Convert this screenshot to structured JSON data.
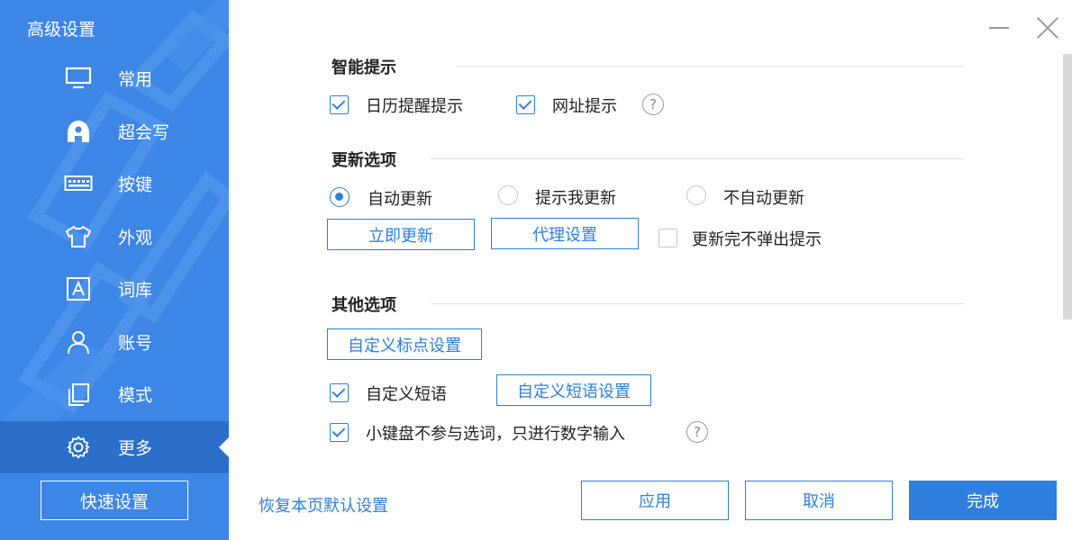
{
  "window": {
    "title": "高级设置"
  },
  "sidebar": {
    "items": [
      {
        "label": "常用",
        "icon": "monitor-icon"
      },
      {
        "label": "超会写",
        "icon": "pen-icon"
      },
      {
        "label": "按键",
        "icon": "keyboard-icon"
      },
      {
        "label": "外观",
        "icon": "tshirt-icon"
      },
      {
        "label": "词库",
        "icon": "letter-a-icon"
      },
      {
        "label": "账号",
        "icon": "user-icon"
      },
      {
        "label": "模式",
        "icon": "layers-icon"
      },
      {
        "label": "更多",
        "icon": "gear-icon",
        "active": true
      }
    ],
    "quick_settings": "快速设置"
  },
  "smart_hints": {
    "title": "智能提示",
    "calendar_reminder": {
      "label": "日历提醒提示",
      "checked": true
    },
    "url_hint": {
      "label": "网址提示",
      "checked": true
    }
  },
  "update_options": {
    "title": "更新选项",
    "radios": [
      {
        "label": "自动更新",
        "selected": true
      },
      {
        "label": "提示我更新",
        "selected": false
      },
      {
        "label": "不自动更新",
        "selected": false
      }
    ],
    "update_now": "立即更新",
    "proxy_settings": "代理设置",
    "no_popup": {
      "label": "更新完不弹出提示",
      "checked": false
    }
  },
  "other_options": {
    "title": "其他选项",
    "punctuation_settings": "自定义标点设置",
    "custom_phrases": {
      "label": "自定义短语",
      "checked": true
    },
    "custom_phrases_settings": "自定义短语设置",
    "keypad_digits": {
      "label": "小键盘不参与选词，只进行数字输入",
      "checked": true
    }
  },
  "footer": {
    "restore_defaults": "恢复本页默认设置",
    "apply": "应用",
    "cancel": "取消",
    "done": "完成"
  },
  "colors": {
    "sidebar": "#3d86e6",
    "sidebar_active": "#2c6fca",
    "accent": "#2f7fdc"
  }
}
